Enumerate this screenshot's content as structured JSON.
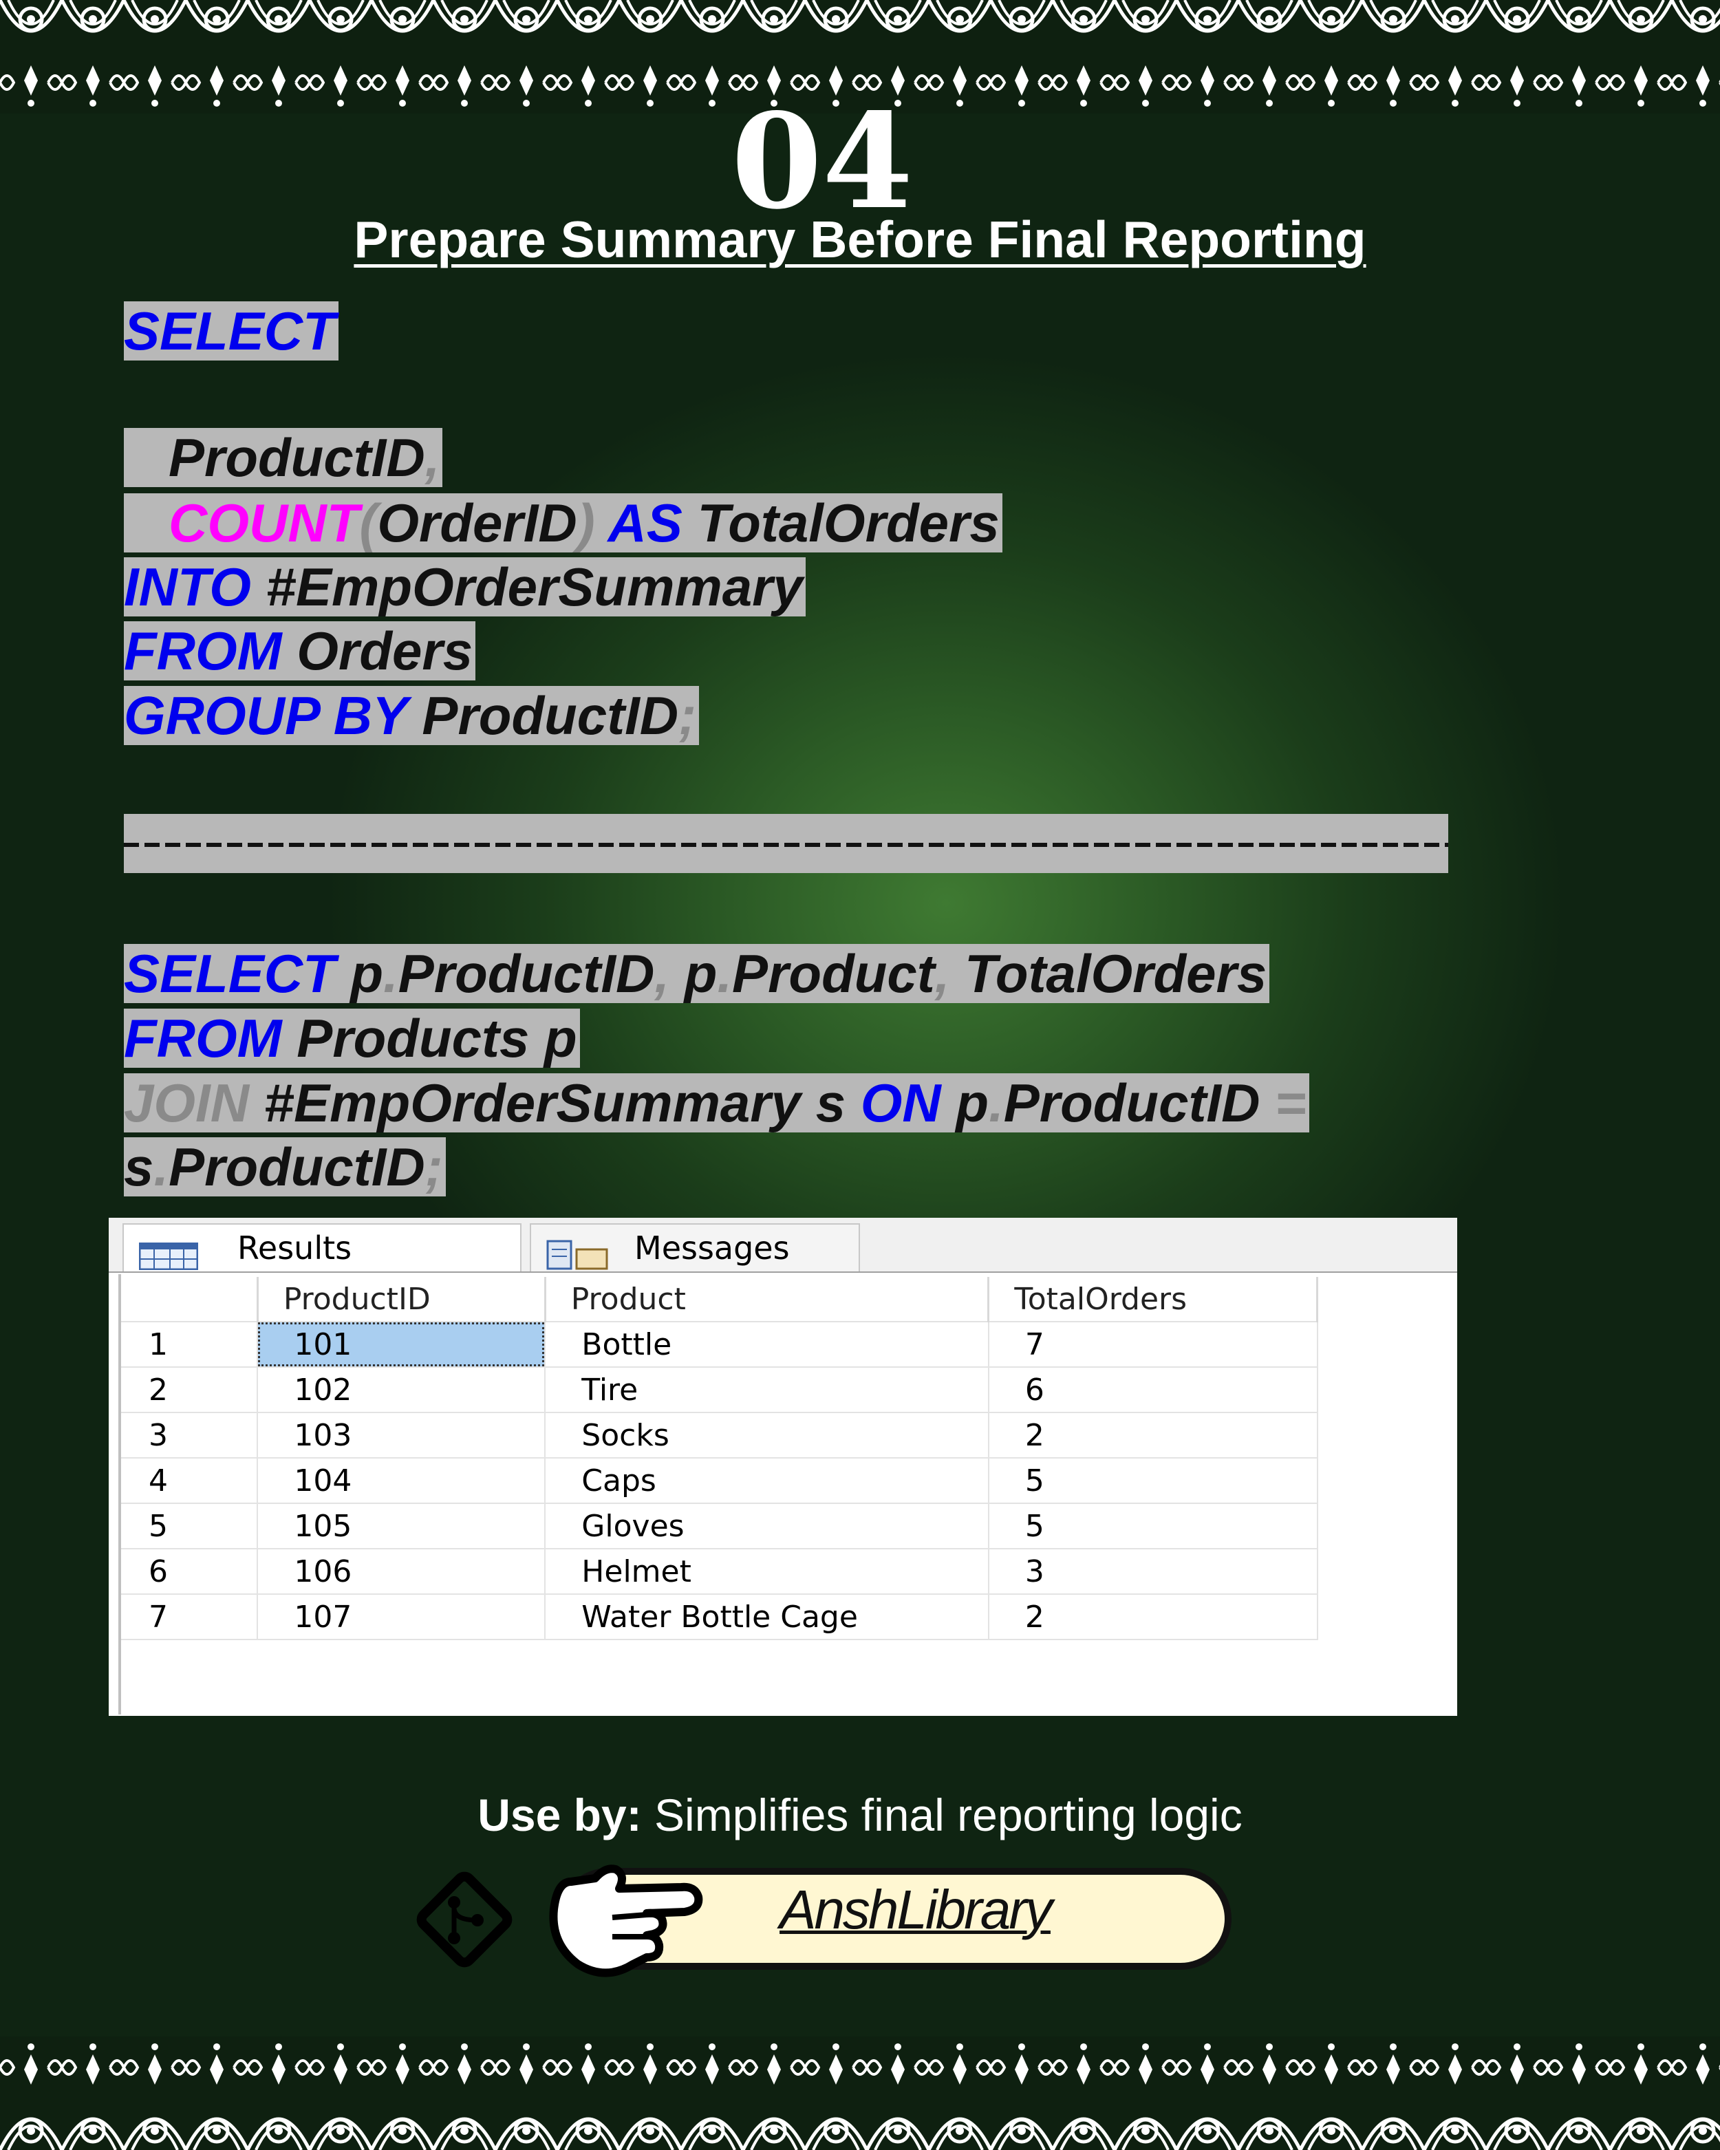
{
  "header": {
    "step_number": "04",
    "title": "Prepare Summary Before Final Reporting"
  },
  "query1": {
    "lines": [
      [
        {
          "t": "SELECT",
          "c": "kw"
        }
      ],
      [
        {
          "t": "   ",
          "c": "tx"
        },
        {
          "t": "ProductID",
          "c": "tx"
        },
        {
          "t": ",",
          "c": "pn"
        }
      ],
      [
        {
          "t": "   ",
          "c": "tx"
        },
        {
          "t": "COUNT",
          "c": "fn"
        },
        {
          "t": "(",
          "c": "pn"
        },
        {
          "t": "OrderID",
          "c": "tx"
        },
        {
          "t": ")",
          "c": "pn"
        },
        {
          "t": " ",
          "c": "tx"
        },
        {
          "t": "AS",
          "c": "kw"
        },
        {
          "t": " TotalOrders",
          "c": "tx"
        }
      ],
      [
        {
          "t": "INTO",
          "c": "kw"
        },
        {
          "t": " #EmpOrderSummary",
          "c": "tx"
        }
      ],
      [
        {
          "t": "FROM",
          "c": "kw"
        },
        {
          "t": " Orders",
          "c": "tx"
        }
      ],
      [
        {
          "t": "GROUP BY",
          "c": "kw"
        },
        {
          "t": " ProductID",
          "c": "tx"
        },
        {
          "t": ";",
          "c": "pn"
        }
      ]
    ]
  },
  "divider": "---------------------------------------------------------------------------",
  "query2": {
    "lines": [
      [
        {
          "t": "SELECT",
          "c": "kw"
        },
        {
          "t": " p",
          "c": "tx"
        },
        {
          "t": ".",
          "c": "pn"
        },
        {
          "t": "ProductID",
          "c": "tx"
        },
        {
          "t": ",",
          "c": "pn"
        },
        {
          "t": " p",
          "c": "tx"
        },
        {
          "t": ".",
          "c": "pn"
        },
        {
          "t": "Product",
          "c": "tx"
        },
        {
          "t": ",",
          "c": "pn"
        },
        {
          "t": " TotalOrders",
          "c": "tx"
        }
      ],
      [
        {
          "t": "FROM",
          "c": "kw"
        },
        {
          "t": " Products p",
          "c": "tx"
        }
      ],
      [
        {
          "t": "JOIN",
          "c": "pn"
        },
        {
          "t": " #EmpOrderSummary s ",
          "c": "tx"
        },
        {
          "t": "ON",
          "c": "kw"
        },
        {
          "t": " p",
          "c": "tx"
        },
        {
          "t": ".",
          "c": "pn"
        },
        {
          "t": "ProductID ",
          "c": "tx"
        },
        {
          "t": "=",
          "c": "pn"
        }
      ],
      [
        {
          "t": "s",
          "c": "tx"
        },
        {
          "t": ".",
          "c": "pn"
        },
        {
          "t": "ProductID",
          "c": "tx"
        },
        {
          "t": ";",
          "c": "pn"
        }
      ]
    ]
  },
  "results": {
    "tabs": {
      "results": "Results",
      "messages": "Messages"
    },
    "columns": [
      "",
      "ProductID",
      "Product",
      "TotalOrders"
    ],
    "rows": [
      [
        "1",
        "101",
        "Bottle",
        "7"
      ],
      [
        "2",
        "102",
        "Tire",
        "6"
      ],
      [
        "3",
        "103",
        "Socks",
        "2"
      ],
      [
        "4",
        "104",
        "Caps",
        "5"
      ],
      [
        "5",
        "105",
        "Gloves",
        "5"
      ],
      [
        "6",
        "106",
        "Helmet",
        "3"
      ],
      [
        "7",
        "107",
        "Water Bottle Cage",
        "2"
      ]
    ]
  },
  "footer": {
    "use_by_label": "Use by:",
    "use_by_text": " Simplifies final reporting logic",
    "brand": "AnshLibrary",
    "icons": [
      "git-icon",
      "pointing-hand-icon"
    ]
  },
  "colors": {
    "keyword": "#0000ee",
    "function": "#ff00ff",
    "punctuation": "#8a8a8a",
    "code_highlight": "#b8b8b8",
    "selected_cell": "#a9cef0",
    "brand_pill": "#fff7d2"
  }
}
